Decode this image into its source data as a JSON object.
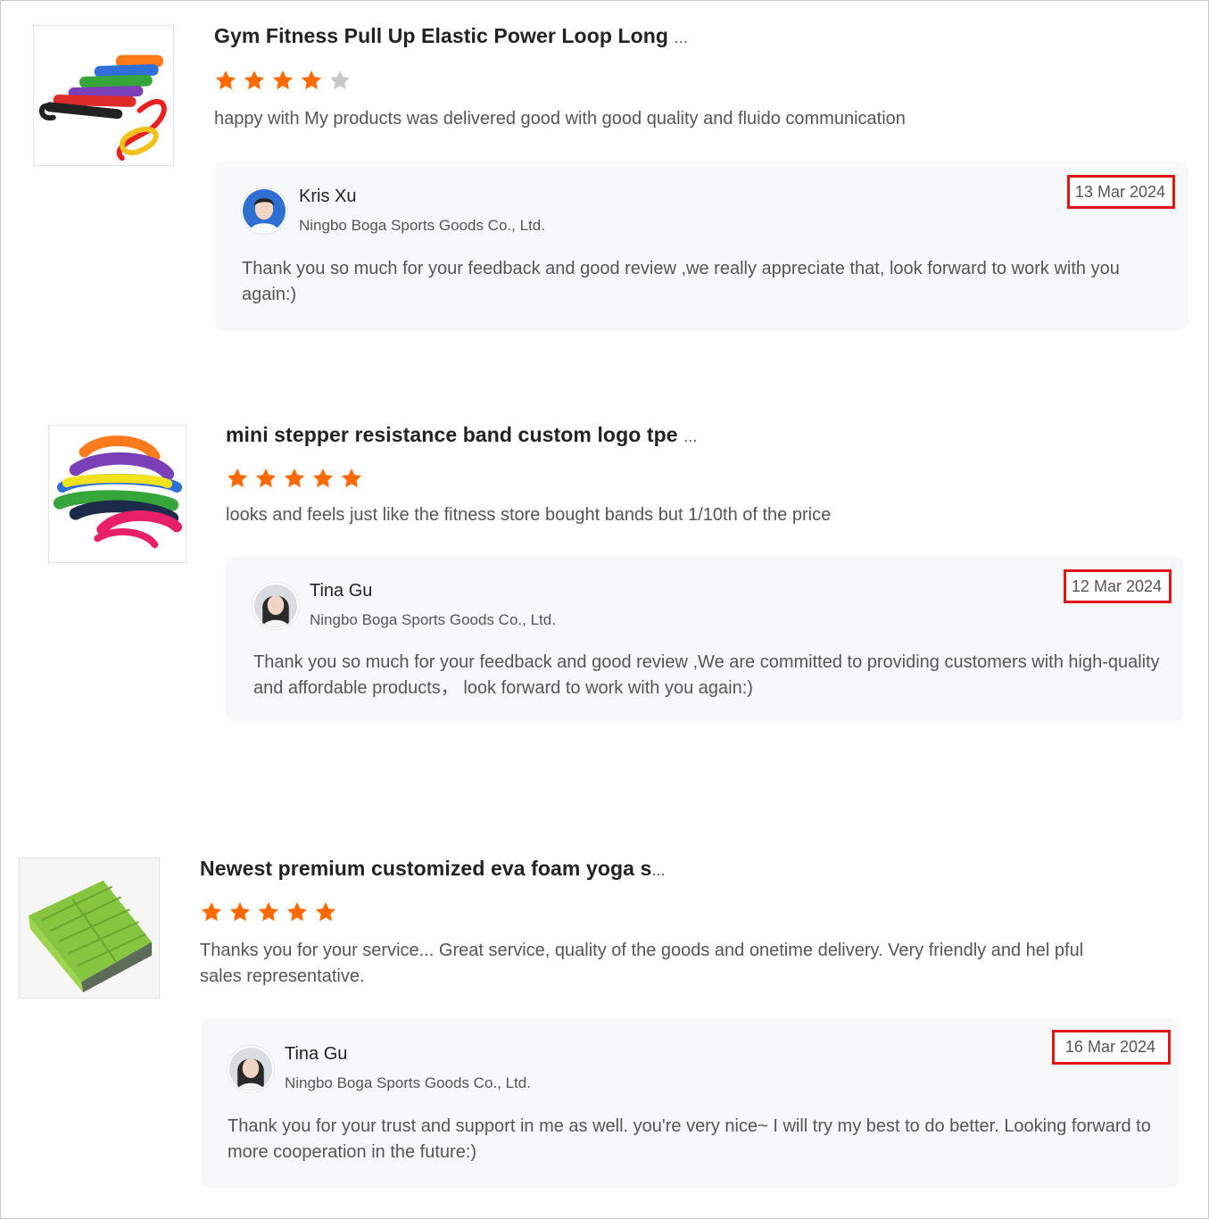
{
  "reviews": [
    {
      "product_title": "Gym Fitness Pull Up Elastic Power Loop Long",
      "title_ellipsis": "...",
      "rating": 4,
      "max_rating": 5,
      "review_text": "happy with My products was delivered good with good quality and fluido communication",
      "product_image_icon": "resistance-bands-image",
      "reply": {
        "name": "Kris Xu",
        "company": "Ningbo Boga Sports Goods Co., Ltd.",
        "date": "13 Mar 2024",
        "text": "Thank you so much for your feedback and good review ,we really appreciate that, look forward to work with you again:)"
      }
    },
    {
      "product_title": "mini stepper resistance band custom logo tpe",
      "title_ellipsis": "...",
      "rating": 5,
      "max_rating": 5,
      "review_text": "looks and feels just like the fitness store bought bands but 1/10th of the price",
      "product_image_icon": "stacked-bands-image",
      "reply": {
        "name": "Tina Gu",
        "company": "Ningbo Boga Sports Goods Co., Ltd.",
        "date": "12 Mar 2024",
        "text": "Thank you so much for your feedback and good review ,We are committed to providing customers with high-quality and affordable products，  look forward to work with you again:)"
      }
    },
    {
      "product_title": "Newest premium customized eva foam yoga s",
      "title_ellipsis": "...",
      "rating": 5,
      "max_rating": 5,
      "review_text": "Thanks you for your service... Great service, quality of the goods and onetime delivery. Very friendly and hel pful sales representative.",
      "product_image_icon": "yoga-foam-block-image",
      "reply": {
        "name": "Tina Gu",
        "company": "Ningbo Boga Sports Goods Co., Ltd.",
        "date": "16 Mar 2024",
        "text": "Thank you for your trust and support in me as well. you're very nice~ I will try my best to do better. Looking forward to more cooperation in the future:)"
      }
    }
  ],
  "colors": {
    "star_filled": "#ff6a00",
    "star_empty": "#c8c8c8",
    "date_highlight": "#e01515",
    "reply_bg": "#f7f8f9"
  }
}
